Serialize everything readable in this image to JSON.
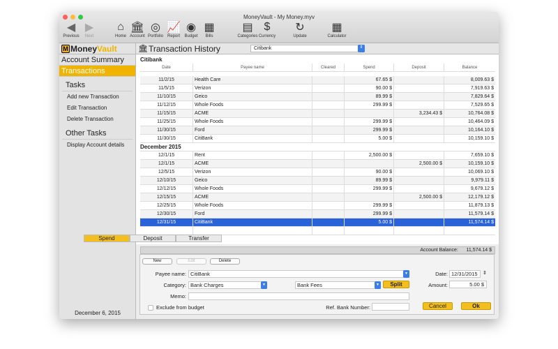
{
  "window": {
    "title": "MoneyVault - My Money.myv"
  },
  "toolbar": [
    {
      "label": "Previous",
      "icon": "◀"
    },
    {
      "label": "Next",
      "icon": "▶"
    },
    {
      "label": "Home",
      "icon": "⌂"
    },
    {
      "label": "Account",
      "icon": "🏛"
    },
    {
      "label": "Portfolio",
      "icon": "◎"
    },
    {
      "label": "Report",
      "icon": "📈"
    },
    {
      "label": "Budget",
      "icon": "◉"
    },
    {
      "label": "Bills",
      "icon": "▦"
    },
    {
      "label": "Categories",
      "icon": "▤"
    },
    {
      "label": "Currency",
      "icon": "$"
    },
    {
      "label": "Update",
      "icon": "↻"
    },
    {
      "label": "Calculator",
      "icon": "▦"
    }
  ],
  "sidebar": {
    "logo_m": "M",
    "logo_a": "Money",
    "logo_b": "Vault",
    "items": [
      "Account Summary",
      "Transactions"
    ],
    "tasks_heading": "Tasks",
    "tasks": [
      "Add new Transaction",
      "Edit Transaction",
      "Delete Transaction"
    ],
    "other_heading": "Other Tasks",
    "other": [
      "Display Account details"
    ],
    "date": "December 6, 2015"
  },
  "header": {
    "title": "Transaction History",
    "account": "Citibank"
  },
  "table": {
    "name": "Citibank",
    "columns": [
      "Date",
      "Payee name",
      "Cleared",
      "Spend",
      "Deposit",
      "Balance"
    ],
    "nov": [
      [
        "11/2/15",
        "Health Care",
        "",
        "67.65 $",
        "",
        "8,009.63 $"
      ],
      [
        "11/5/15",
        "Verizon",
        "",
        "90.00 $",
        "",
        "7,919.63 $"
      ],
      [
        "11/10/15",
        "Geico",
        "",
        "89.99 $",
        "",
        "7,829.64 $"
      ],
      [
        "11/12/15",
        "Whole Foods",
        "",
        "299.99 $",
        "",
        "7,529.65 $"
      ],
      [
        "11/15/15",
        "ACME",
        "",
        "",
        "3,234.43 $",
        "10,764.08 $"
      ],
      [
        "11/25/15",
        "Whole Foods",
        "",
        "299.99 $",
        "",
        "10,464.09 $"
      ],
      [
        "11/30/15",
        "Ford",
        "",
        "299.99 $",
        "",
        "10,164.10 $"
      ],
      [
        "11/30/15",
        "CitiBank",
        "",
        "5.00 $",
        "",
        "10,159.10 $"
      ]
    ],
    "month": "December 2015",
    "dec": [
      [
        "12/1/15",
        "Rent",
        "",
        "2,500.00 $",
        "",
        "7,659.10 $"
      ],
      [
        "12/1/15",
        "ACME",
        "",
        "",
        "2,500.00 $",
        "10,159.10 $"
      ],
      [
        "12/5/15",
        "Verizon",
        "",
        "90.00 $",
        "",
        "10,069.10 $"
      ],
      [
        "12/10/15",
        "Geico",
        "",
        "89.99 $",
        "",
        "9,979.11 $"
      ],
      [
        "12/12/15",
        "Whole Foods",
        "",
        "299.99 $",
        "",
        "9,679.12 $"
      ],
      [
        "12/15/15",
        "ACME",
        "",
        "",
        "2,500.00 $",
        "12,179.12 $"
      ],
      [
        "12/25/15",
        "Whole Foods",
        "",
        "299.99 $",
        "",
        "11,879.13 $"
      ],
      [
        "12/30/15",
        "Ford",
        "",
        "299.99 $",
        "",
        "11,579.14 $"
      ],
      [
        "12/31/15",
        "CitiBank",
        "",
        "5.00 $",
        "",
        "11,574.14 $"
      ]
    ],
    "balance_label": "Account Balance:",
    "balance": "11,574.14 $"
  },
  "form": {
    "tabs": [
      "Spend",
      "Deposit",
      "Transfer"
    ],
    "new": "New",
    "edit": "Edit",
    "delete": "Delete",
    "payee_label": "Payee name:",
    "payee": "CitiBank",
    "category_label": "Category:",
    "category": "Bank Charges",
    "subcategory": "Bank Fees",
    "split": "Split",
    "memo_label": "Memo:",
    "memo": "",
    "exclude": "Exclude from budget",
    "ref_label": "Ref. Bank Number:",
    "ref": "",
    "date_label": "Date:",
    "date": "12/31/2015",
    "amount_label": "Amount:",
    "amount": "5.00 $",
    "cancel": "Cancel",
    "ok": "Ok"
  },
  "colors": {
    "accent": "#f3bf1e",
    "selection": "#2a62d9"
  }
}
